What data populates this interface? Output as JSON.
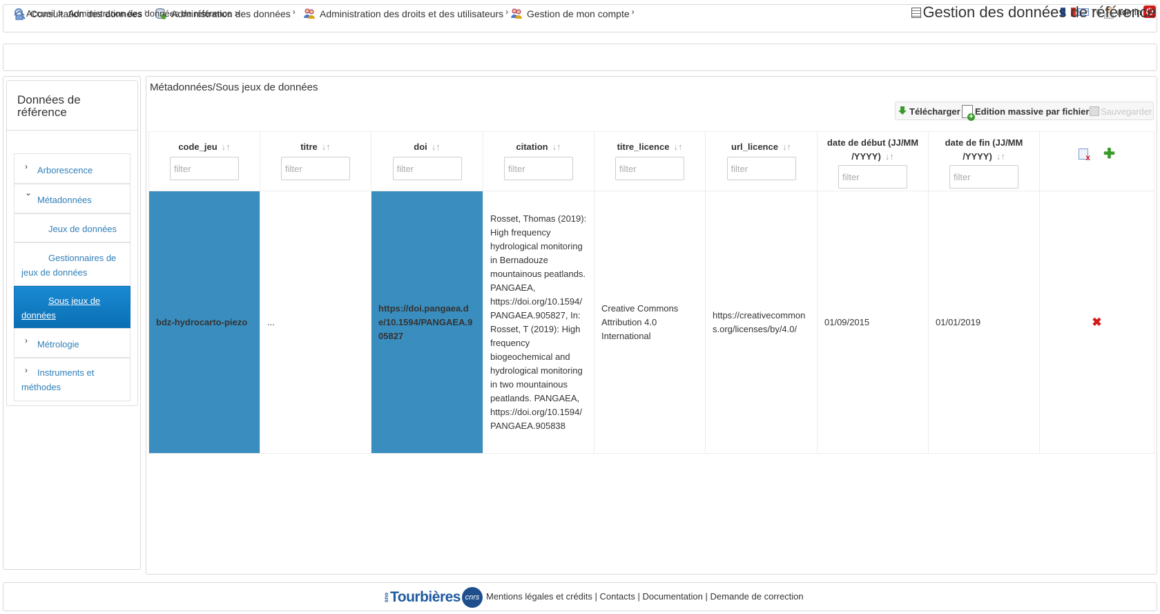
{
  "nav": {
    "items": [
      {
        "label": "Consultation des données",
        "caret": "›",
        "icon": "magnifier-icon"
      },
      {
        "label": "Administration des données",
        "caret": "›",
        "icon": "database-icon"
      },
      {
        "label": "Administration des droits et des utilisateurs",
        "caret": "›",
        "icon": "users-icon"
      },
      {
        "label": "Gestion de mon compte",
        "caret": "›",
        "icon": "users-icon"
      }
    ],
    "message_count": "76",
    "username": "admin",
    "power_symbol": "⏻",
    "flag_colors": [
      "#1f4fa3",
      "#ffffff",
      "#d52b1e"
    ]
  },
  "breadcrumb": {
    "home": "Accueil",
    "sep": ">",
    "current": "Administration des données de référence >"
  },
  "page_title": "Gestion des données de référence",
  "sidebar": {
    "title": "Données de référence",
    "items": [
      {
        "label": "Arborescence",
        "chevron": "›"
      },
      {
        "label": "Métadonnées",
        "chevron": "⌄"
      },
      {
        "label": "Jeux de données"
      },
      {
        "label": "Gestionnaires de jeux de données"
      },
      {
        "label": "Sous jeux de données"
      },
      {
        "label": "Métrologie",
        "chevron": "›"
      },
      {
        "label": "Instruments et méthodes",
        "chevron": "›"
      }
    ]
  },
  "main": {
    "title": "Métadonnées/Sous jeux de données",
    "toolbar": {
      "download": "Télécharger",
      "bulk_edit": "Edition massive par fichier",
      "save": "Sauvegarder"
    },
    "filter_placeholder": "filter",
    "sort_glyph": "↓↑",
    "columns": [
      "code_jeu",
      "titre",
      "doi",
      "citation",
      "titre_licence",
      "url_licence",
      "date de début (JJ/MM /YYYY)",
      "date de fin (JJ/MM /YYYY)"
    ],
    "rows": [
      {
        "code_jeu": "bdz-hydrocarto-piezo",
        "titre": "...",
        "doi": "https://doi.pangaea.de/10.1594/PANGAEA.905827",
        "citation": "Rosset, Thomas (2019): High frequency hydrological monitoring in Bernadouze mountainous peatlands. PANGAEA, https://doi.org/10.1594/PANGAEA.905827, In: Rosset, T (2019): High frequency biogeochemical and hydrological monitoring in two mountainous peatlands. PANGAEA, https://doi.org/10.1594/PANGAEA.905838",
        "titre_licence": "Creative Commons Attribution 4.0 International",
        "url_licence": "https://creativecommons.org/licenses/by/4.0/",
        "date_debut": "01/09/2015",
        "date_fin": "01/01/2019",
        "delete_glyph": "✖"
      }
    ],
    "plus_glyph": "✚"
  },
  "footer": {
    "logo_prefix": "sno",
    "logo_text": "Tourbières",
    "cnrs": "cnrs",
    "links": [
      "Mentions légales et crédits",
      "Contacts",
      "Documentation",
      "Demande de correction"
    ],
    "sep": " | "
  }
}
